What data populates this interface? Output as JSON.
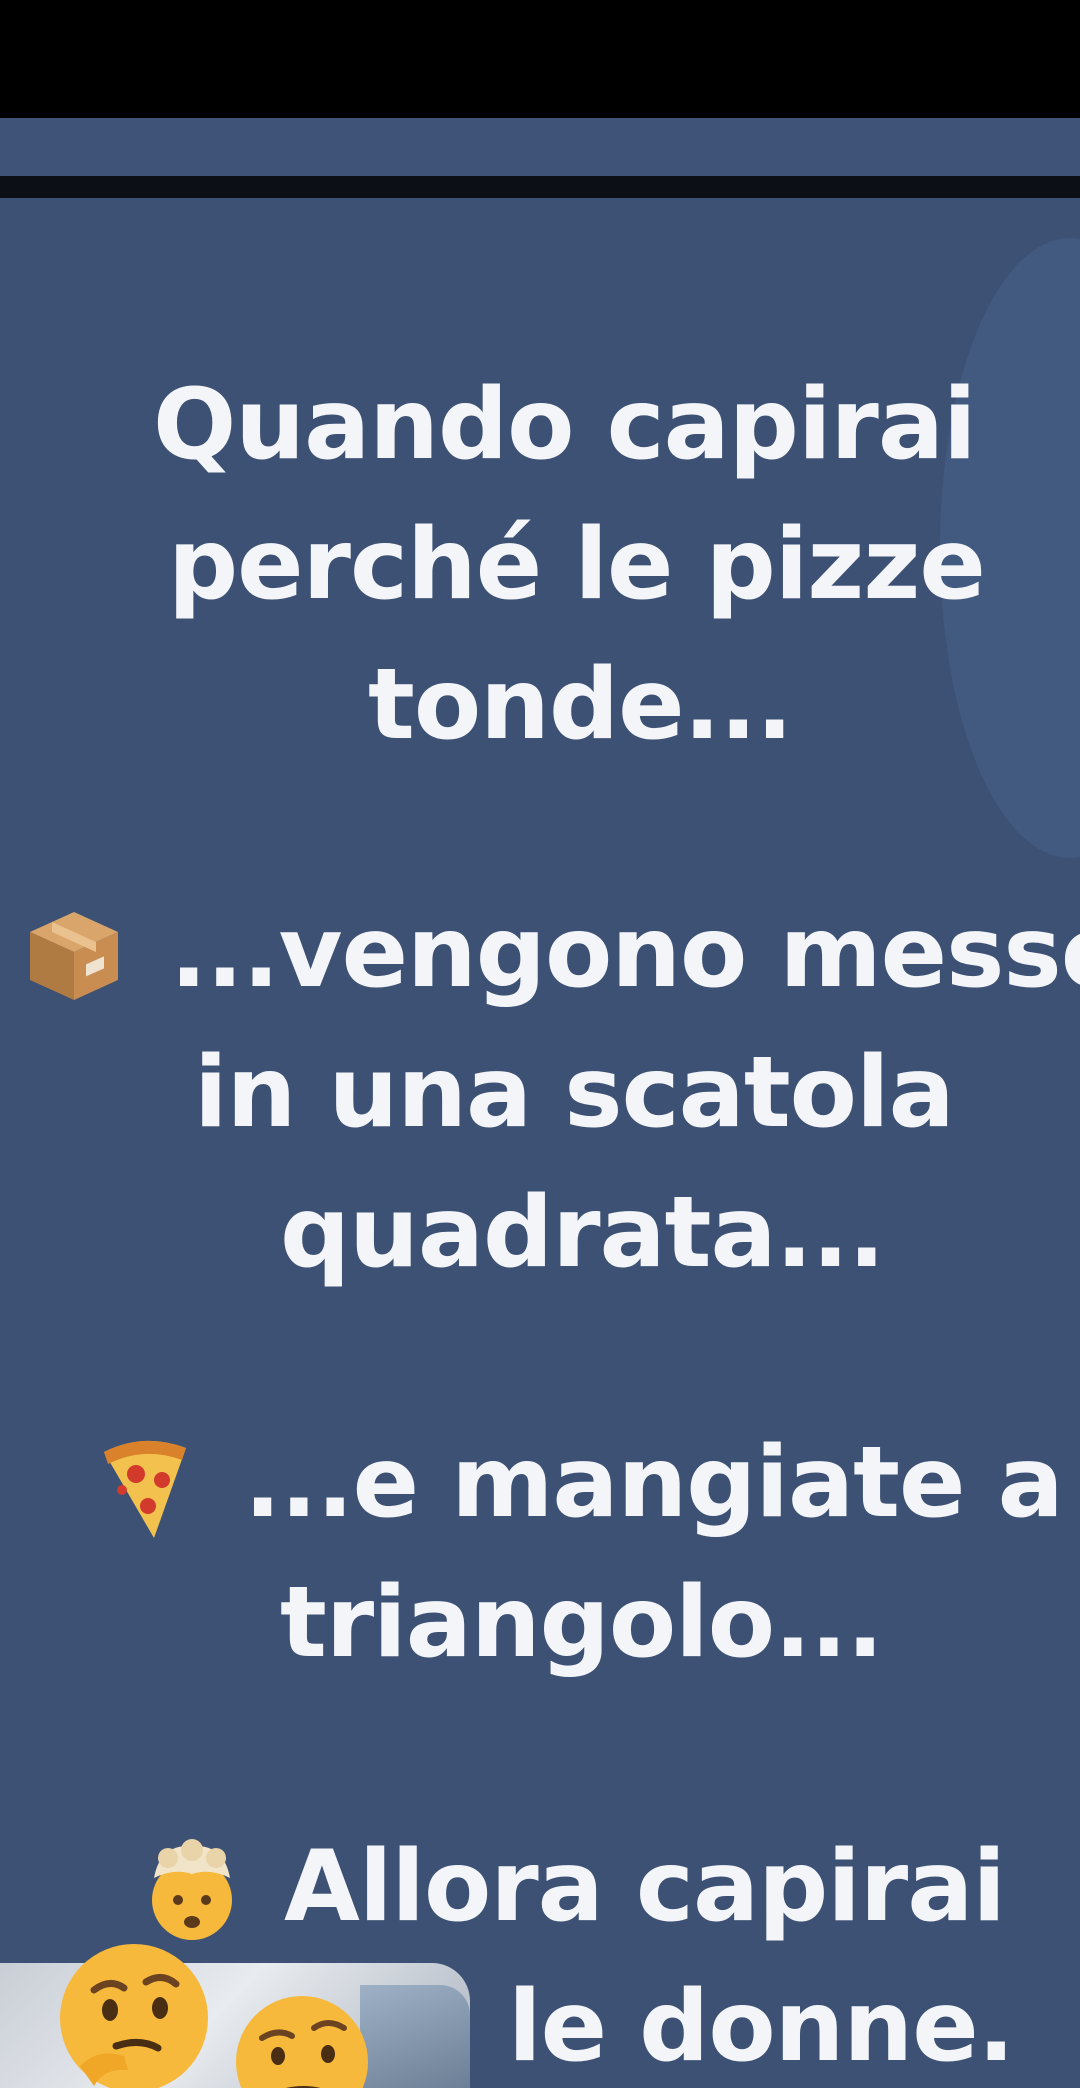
{
  "post": {
    "line1": "Quando capirai",
    "line2": "perché le pizze",
    "line3": "tonde...",
    "line4": "...vengono messe",
    "line5": "in una scatola",
    "line6": "quadrata...",
    "line7": "...e mangiate a",
    "line8": "triangolo...",
    "line9": "Allora capirai",
    "line10": "le donne."
  },
  "icons": {
    "box": "package-icon",
    "pizza": "pizza-icon",
    "mind_blown": "exploding-head-icon",
    "thinking": "thinking-face-icon",
    "raised_brow": "face-with-raised-eyebrow-icon"
  },
  "colors": {
    "card_bg": "#3d5174",
    "header_strip": "#3e5377",
    "text": "#f3f5f8"
  }
}
